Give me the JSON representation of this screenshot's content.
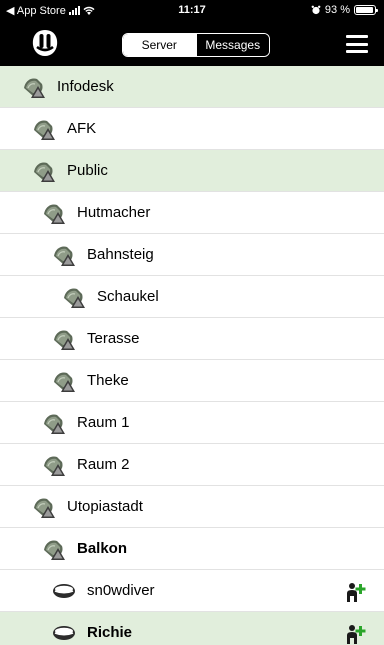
{
  "status_bar": {
    "back_app": "◀ App Store",
    "time": "11:17",
    "battery": "93 %",
    "battery_level": 0.93
  },
  "nav": {
    "segments": [
      {
        "label": "Server",
        "selected": true
      },
      {
        "label": "Messages",
        "selected": false
      }
    ],
    "menu_icon": "hamburger-icon",
    "logo_icon": "app-logo-icon"
  },
  "colors": {
    "highlight": "#e1eedc",
    "bar": "#000000",
    "add_user_plus": "#2aa52a"
  },
  "list": [
    {
      "label": "Infodesk",
      "type": "channel",
      "highlighted": true,
      "bold": false
    },
    {
      "label": "AFK",
      "type": "channel",
      "highlighted": false,
      "bold": false
    },
    {
      "label": "Public",
      "type": "channel",
      "highlighted": true,
      "bold": false
    },
    {
      "label": "Hutmacher",
      "type": "channel",
      "highlighted": false,
      "bold": false
    },
    {
      "label": "Bahnsteig",
      "type": "channel",
      "highlighted": false,
      "bold": false
    },
    {
      "label": "Schaukel",
      "type": "channel",
      "highlighted": false,
      "bold": false
    },
    {
      "label": "Terasse",
      "type": "channel",
      "highlighted": false,
      "bold": false
    },
    {
      "label": "Theke",
      "type": "channel",
      "highlighted": false,
      "bold": false
    },
    {
      "label": "Raum 1",
      "type": "channel",
      "highlighted": false,
      "bold": false
    },
    {
      "label": "Raum 2",
      "type": "channel",
      "highlighted": false,
      "bold": false
    },
    {
      "label": "Utopiastadt",
      "type": "channel",
      "highlighted": false,
      "bold": false
    },
    {
      "label": "Balkon",
      "type": "channel",
      "highlighted": false,
      "bold": true
    },
    {
      "label": "sn0wdiver",
      "type": "user",
      "highlighted": false,
      "bold": false
    },
    {
      "label": "Richie",
      "type": "user",
      "highlighted": true,
      "bold": true
    }
  ]
}
